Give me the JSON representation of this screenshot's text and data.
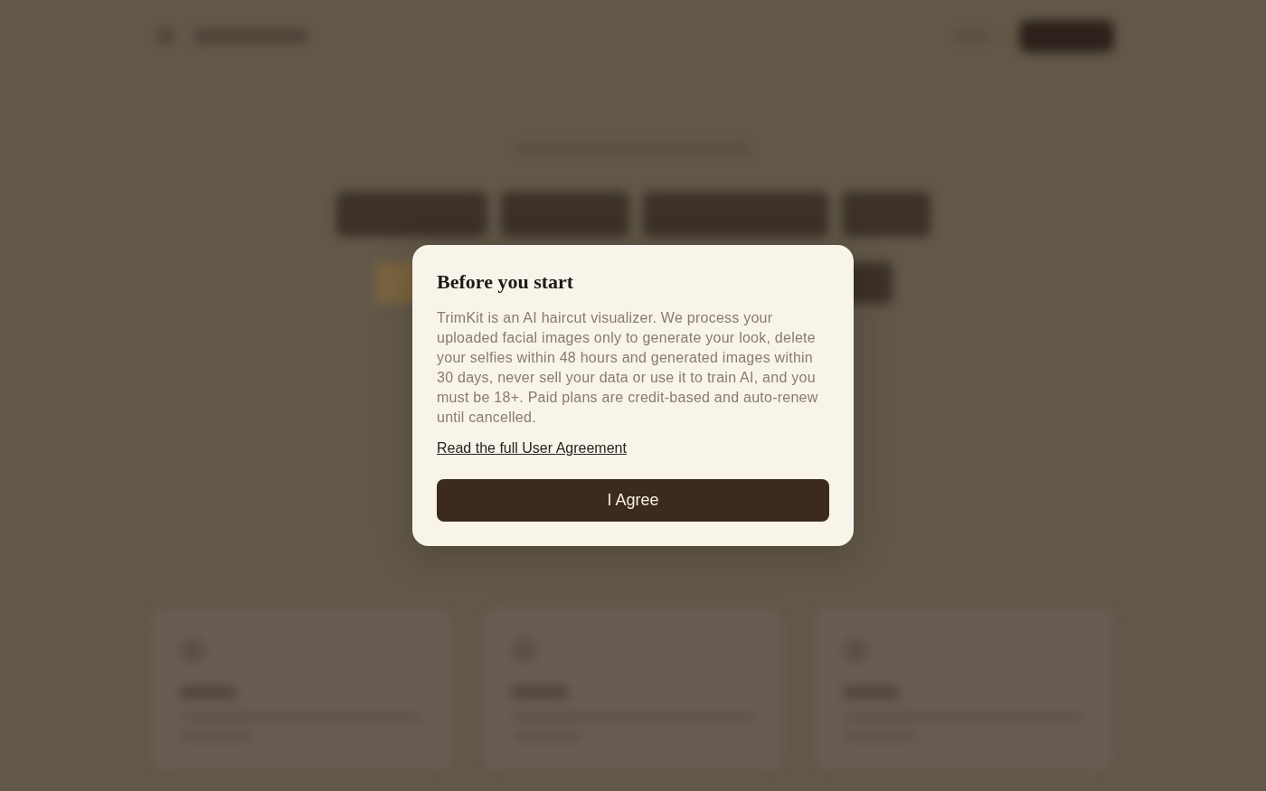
{
  "backdrop": {
    "blurred": true
  },
  "dialog": {
    "title": "Before you start",
    "body": "TrimKit is an AI haircut visualizer. We process your uploaded facial images only to generate your look, delete your selfies within 48 hours and generated images within 30 days, never sell your data or use it to train AI, and you must be 18+. Paid plans are credit-based and auto-renew until cancelled.",
    "link": "Read the full User Agreement",
    "button": "I Agree"
  }
}
